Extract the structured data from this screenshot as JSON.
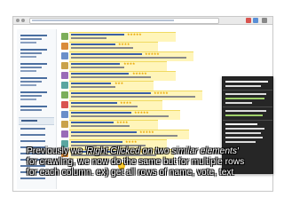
{
  "caption": {
    "line1_prefix": "Previously we ",
    "line1_emphasis": "'Right Clicked on two similar elements'",
    "line2": "for crawling, we now do the same but for multiple rows",
    "line3": "for each column. ex) get all rows of name, vote, text"
  },
  "colors": {
    "highlight": "#ffe85a",
    "link": "#3b5fa5",
    "star": "#e8a400",
    "popup_bg": "#262626"
  },
  "icons": [
    "browser-back-icon",
    "browser-forward-icon",
    "bookmark-icon",
    "extension-icon",
    "menu-icon",
    "cursor-highlight-icon"
  ]
}
